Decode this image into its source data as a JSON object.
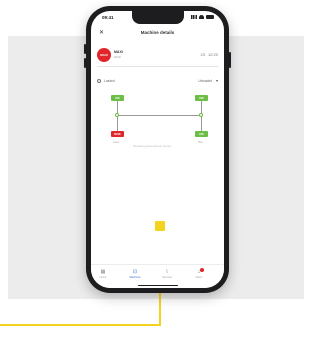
{
  "status_bar": {
    "time": "09:41"
  },
  "header": {
    "title": "Machine details",
    "close_icon": "close-icon"
  },
  "device": {
    "brand_logo_text": "MAXI",
    "name": "MAXI",
    "subtitle": "2010",
    "metrics": [
      "23",
      "12:20"
    ]
  },
  "filter": {
    "left_label": "Loaded",
    "right_label": "Unloaded"
  },
  "diagram": {
    "nodes": [
      {
        "label": "OK",
        "color": "#6dbe45"
      },
      {
        "label": "OK",
        "color": "#6dbe45"
      },
      {
        "label": "NOK",
        "color": "#e0262b"
      },
      {
        "label": "OK",
        "color": "#6dbe45"
      }
    ],
    "captions": [
      "Loss",
      "Tire"
    ],
    "note": "Remaining wear and tear are fine"
  },
  "tab_bar": {
    "items": [
      {
        "label": "Home",
        "icon": "grid-icon",
        "active": false
      },
      {
        "label": "Machines",
        "icon": "machine-icon",
        "active": true
      },
      {
        "label": "Services",
        "icon": "wrench-icon",
        "active": false
      },
      {
        "label": "Alerts",
        "icon": "bell-icon",
        "active": false
      }
    ]
  },
  "colors": {
    "accent": "#3a6fcf",
    "ok": "#6dbe45",
    "alert": "#e0262b",
    "callout": "#f4d31f"
  }
}
